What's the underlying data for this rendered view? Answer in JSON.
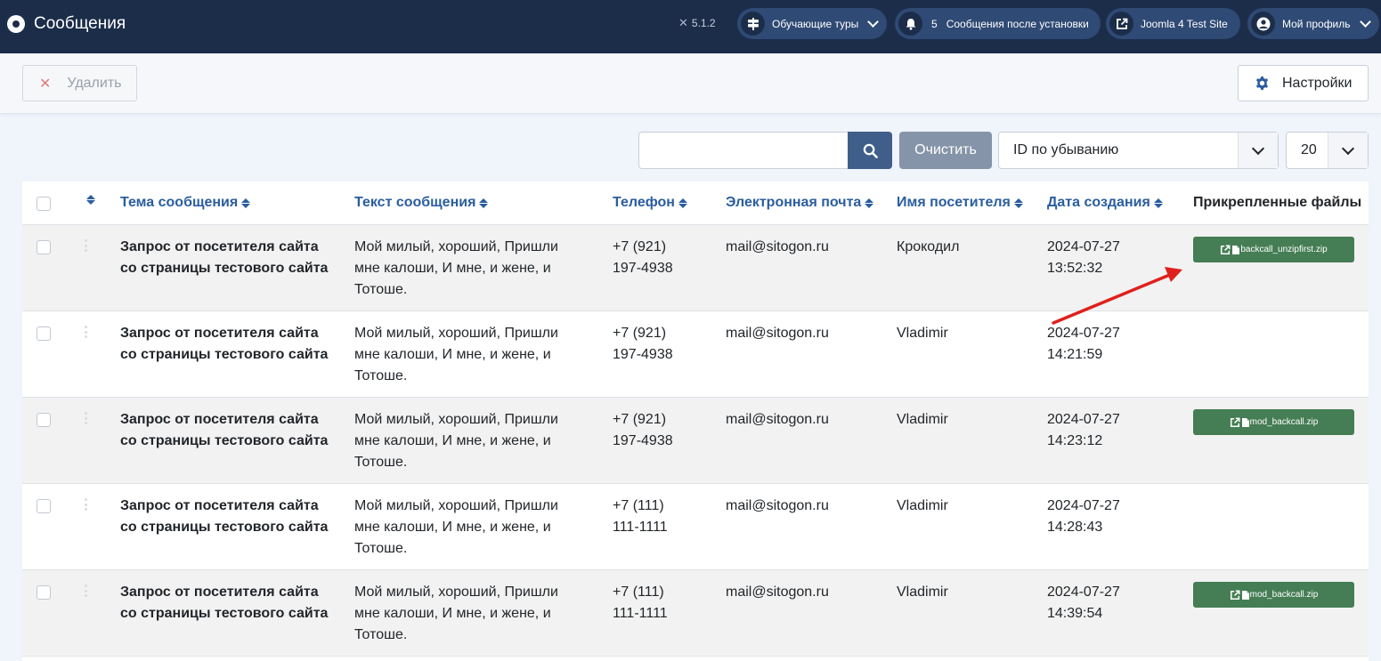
{
  "header": {
    "title": "Сообщения",
    "version": "5.1.2",
    "tours_label": "Обучающие туры",
    "notifications_count": "5",
    "notifications_label": "Сообщения после установки",
    "site_label": "Joomla 4 Test Site",
    "profile_label": "Мой профиль"
  },
  "toolbar": {
    "delete_label": "Удалить",
    "settings_label": "Настройки"
  },
  "filters": {
    "search_value": "",
    "search_placeholder": "",
    "clear_label": "Очистить",
    "sort_value": "ID по убыванию",
    "limit_value": "20"
  },
  "table": {
    "columns": [
      "Тема сообщения",
      "Текст сообщения",
      "Телефон",
      "Электронная почта",
      "Имя посетителя",
      "Дата создания",
      "Прикрепленные файлы"
    ],
    "rows": [
      {
        "subject_1": "Запрос от посетителя сайта",
        "subject_2": "со страницы тестового сайта",
        "text_1": "Мой милый, хороший, Пришли",
        "text_2": "мне калоши, И мне, и жене, и",
        "text_3": "Тотоше.",
        "phone_1": "+7 (921)",
        "phone_2": "197-4938",
        "email": "mail@sitogon.ru",
        "name": "Крокодил",
        "date": "2024-07-27",
        "time": "13:52:32",
        "file": "backcall_unzipfirst.zip"
      },
      {
        "subject_1": "Запрос от посетителя сайта",
        "subject_2": "со страницы тестового сайта",
        "text_1": "Мой милый, хороший, Пришли",
        "text_2": "мне калоши, И мне, и жене, и",
        "text_3": "Тотоше.",
        "phone_1": "+7 (921)",
        "phone_2": "197-4938",
        "email": "mail@sitogon.ru",
        "name": "Vladimir",
        "date": "2024-07-27",
        "time": "14:21:59",
        "file": ""
      },
      {
        "subject_1": "Запрос от посетителя сайта",
        "subject_2": "со страницы тестового сайта",
        "text_1": "Мой милый, хороший, Пришли",
        "text_2": "мне калоши, И мне, и жене, и",
        "text_3": "Тотоше.",
        "phone_1": "+7 (921)",
        "phone_2": "197-4938",
        "email": "mail@sitogon.ru",
        "name": "Vladimir",
        "date": "2024-07-27",
        "time": "14:23:12",
        "file": "mod_backcall.zip"
      },
      {
        "subject_1": "Запрос от посетителя сайта",
        "subject_2": "со страницы тестового сайта",
        "text_1": "Мой милый, хороший, Пришли",
        "text_2": "мне калоши, И мне, и жене, и",
        "text_3": "Тотоше.",
        "phone_1": "+7 (111)",
        "phone_2": "111-1111",
        "email": "mail@sitogon.ru",
        "name": "Vladimir",
        "date": "2024-07-27",
        "time": "14:28:43",
        "file": ""
      },
      {
        "subject_1": "Запрос от посетителя сайта",
        "subject_2": "со страницы тестового сайта",
        "text_1": "Мой милый, хороший, Пришли",
        "text_2": "мне калоши, И мне, и жене, и",
        "text_3": "Тотоше.",
        "phone_1": "+7 (111)",
        "phone_2": "111-1111",
        "email": "mail@sitogon.ru",
        "name": "Vladimir",
        "date": "2024-07-27",
        "time": "14:39:54",
        "file": "mod_backcall.zip"
      }
    ]
  },
  "colors": {
    "header_bg": "#1c2d4a",
    "pill_bg": "#2f4a74",
    "link_blue": "#2a5d9f",
    "file_button": "#457d54",
    "annotation_arrow": "#e0201c"
  }
}
